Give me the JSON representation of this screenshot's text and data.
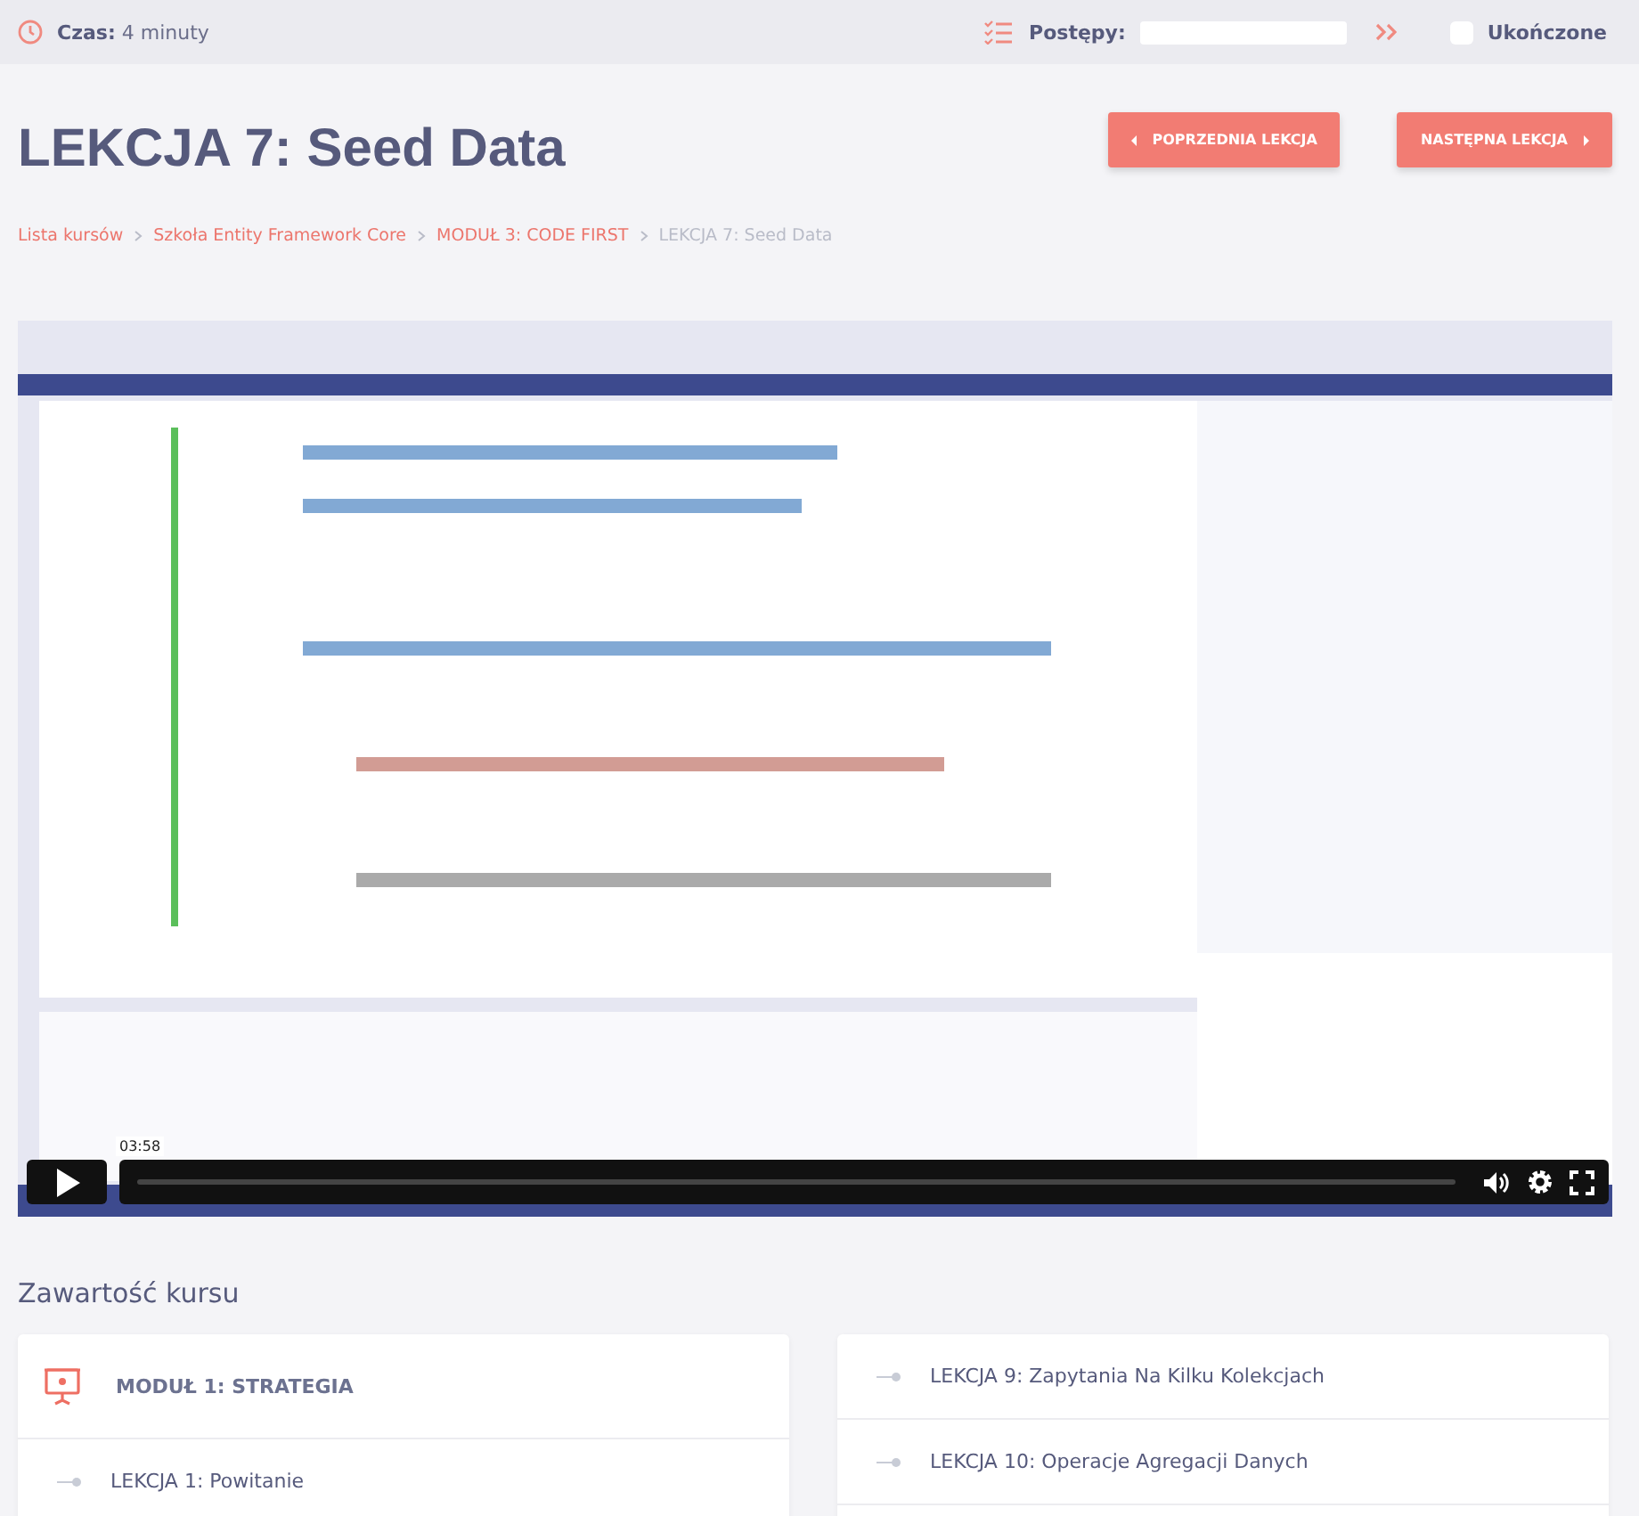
{
  "top_bar": {
    "time_label": "Czas:",
    "time_value": "4 minuty",
    "progress_label": "Postępy:",
    "progress": {
      "level": 0
    },
    "completed": {
      "label": "Ukończone",
      "checked": false
    }
  },
  "title": "LEKCJA 7: Seed Data",
  "nav_buttons": [
    {
      "label": "POPRZEDNIA LEKCJA",
      "kind": "prev"
    },
    {
      "label": "NASTĘPNA LEKCJA",
      "kind": "next"
    }
  ],
  "breadcrumbs": [
    {
      "label": "Lista kursów",
      "link": true
    },
    {
      "label": "Szkoła Entity Framework Core",
      "link": true
    },
    {
      "label": "MODUŁ 3: CODE FIRST",
      "link": true
    },
    {
      "label": "LEKCJA 7: Seed Data",
      "link": false
    }
  ],
  "video": {
    "kind": "picture",
    "time_tooltip": "03:58"
  },
  "contents": {
    "heading": "Zawartość kursu",
    "columns": [
      [
        {
          "kind": "module",
          "label": "MODUŁ 1: STRATEGIA"
        },
        {
          "kind": "lesson",
          "label": "LEKCJA 1: Powitanie"
        }
      ],
      [
        {
          "kind": "lesson",
          "label": "LEKCJA 9: Zapytania Na Kilku Kolekcjach"
        },
        {
          "kind": "lesson",
          "label": "LEKCJA 10: Operacje Agregacji Danych"
        }
      ]
    ]
  }
}
